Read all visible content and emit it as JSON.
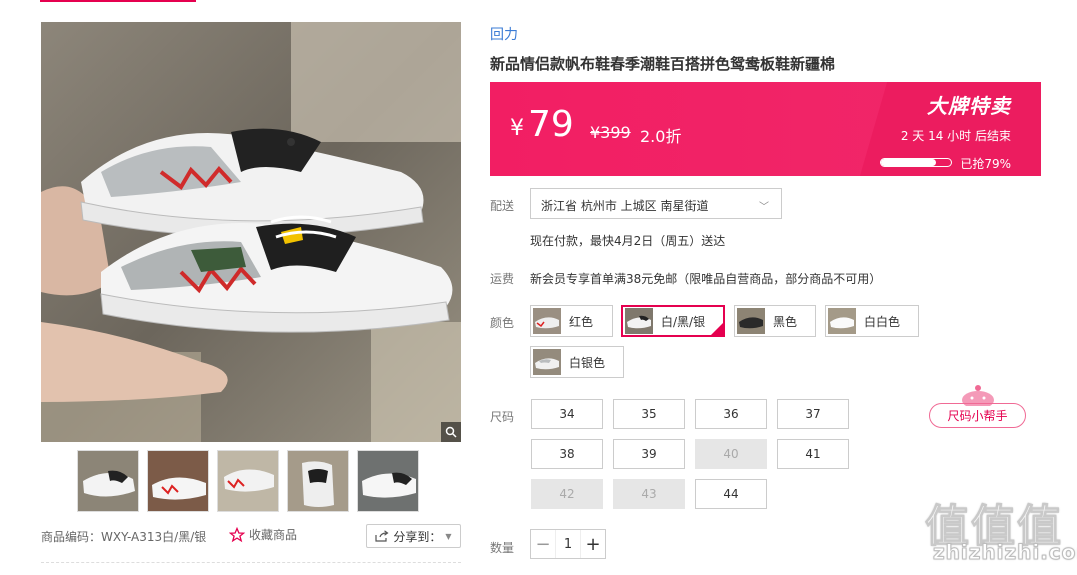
{
  "product": {
    "brand": "回力",
    "title": "新品情侣款帆布鞋春季潮鞋百搭拼色鸳鸯板鞋新疆棉"
  },
  "price": {
    "currency": "¥",
    "current": "79",
    "original": "¥399",
    "discount": "2.0折"
  },
  "flash_sale": {
    "title": "大牌特卖",
    "countdown": "2 天 14 小时 后结束",
    "progress_label": "已抢79%",
    "progress_fraction": 0.79
  },
  "delivery": {
    "label": "配送",
    "address": "浙江省 杭州市 上城区 南星街道",
    "note": "现在付款，最快4月2日（周五）送达"
  },
  "shipping": {
    "label": "运费",
    "note": "新会员专享首单满38元免邮（限唯品自营商品，部分商品不可用）"
  },
  "colors": {
    "label": "颜色",
    "options": [
      {
        "name": "红色",
        "selected": false
      },
      {
        "name": "白/黑/银",
        "selected": true
      },
      {
        "name": "黑色",
        "selected": false
      },
      {
        "name": "白白色",
        "selected": false
      },
      {
        "name": "白银色",
        "selected": false
      }
    ]
  },
  "sizes": {
    "label": "尺码",
    "options": [
      {
        "size": "34",
        "available": true
      },
      {
        "size": "35",
        "available": true
      },
      {
        "size": "36",
        "available": true
      },
      {
        "size": "37",
        "available": true
      },
      {
        "size": "38",
        "available": true
      },
      {
        "size": "39",
        "available": true
      },
      {
        "size": "40",
        "available": false
      },
      {
        "size": "41",
        "available": true
      },
      {
        "size": "42",
        "available": false
      },
      {
        "size": "43",
        "available": false
      },
      {
        "size": "44",
        "available": true
      }
    ],
    "helper": "尺码小帮手"
  },
  "quantity": {
    "label": "数量",
    "value": "1",
    "minus": "−",
    "plus": "+"
  },
  "gallery": {
    "sku_code": "商品编码：WXY-A313白/黑/银",
    "favorite_label": "收藏商品",
    "share_label": "分享到：",
    "thumbnail_count": 5
  },
  "watermark": {
    "logo": "值值值",
    "site": "zhizhizhi.com"
  },
  "colors_theme": {
    "accent": "#e5004f",
    "price_bg": "#f21e63",
    "brand_link": "#3a7bd5"
  }
}
